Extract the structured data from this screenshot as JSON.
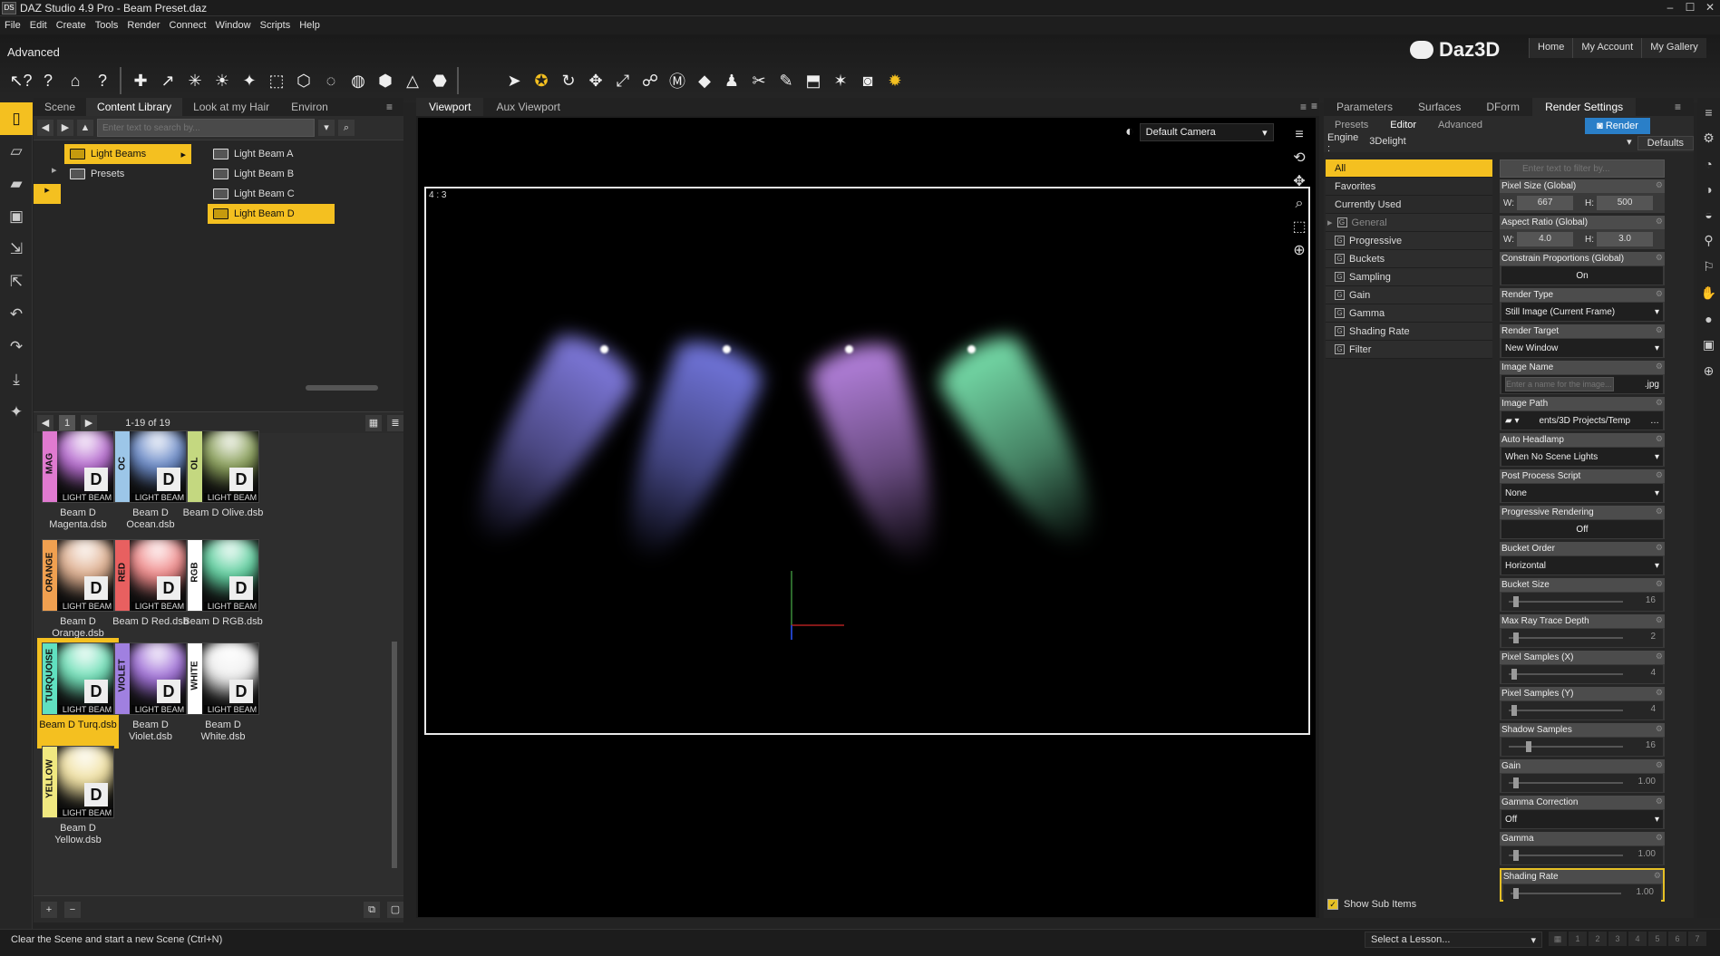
{
  "window": {
    "title": "DAZ Studio 4.9 Pro - Beam Preset.daz",
    "app_icon": "DS"
  },
  "menu": [
    "File",
    "Edit",
    "Create",
    "Tools",
    "Render",
    "Connect",
    "Window",
    "Scripts",
    "Help"
  ],
  "layout_label": "Advanced",
  "brand": {
    "name": "Daz3D"
  },
  "top_links": [
    "Home",
    "My Account",
    "My Gallery"
  ],
  "content_library": {
    "tabs": [
      "Scene",
      "Content Library",
      "Look at my Hair",
      "Environ"
    ],
    "active_tab": "Content Library",
    "search_placeholder": "Enter text to search by...",
    "folders_col1": [
      {
        "label": "Light Beams",
        "selected": true
      },
      {
        "label": "Presets",
        "selected": false
      }
    ],
    "folders_col2": [
      {
        "label": "Light Beam A"
      },
      {
        "label": "Light Beam B"
      },
      {
        "label": "Light Beam C"
      },
      {
        "label": "Light Beam D",
        "selected": true
      }
    ],
    "pager": "1-19 of 19",
    "page_num": "1",
    "items": [
      {
        "caption": "Beam D Magenta.dsb",
        "band": "MAG",
        "band_color": "#e07ad0",
        "glow": "#b76cd0"
      },
      {
        "caption": "Beam D Ocean.dsb",
        "band": "OC",
        "band_color": "#9cc6e8",
        "glow": "#6a8ac8"
      },
      {
        "caption": "Beam D Olive.dsb",
        "band": "OL",
        "band_color": "#c4d880",
        "glow": "#8aa05a"
      },
      {
        "caption": "Beam D Orange.dsb",
        "band": "ORANGE",
        "band_color": "#f0a050",
        "glow": "#e0b090"
      },
      {
        "caption": "Beam D Red.dsb",
        "band": "RED",
        "band_color": "#e86060",
        "glow": "#f08a8a"
      },
      {
        "caption": "Beam D RGB.dsb",
        "band": "RGB",
        "band_color": "#ffffff",
        "glow": "#60d0a0"
      },
      {
        "caption": "Beam D Turq.dsb",
        "band": "TURQUOISE",
        "band_color": "#60e0c0",
        "glow": "#70e0b8",
        "selected": true
      },
      {
        "caption": "Beam D Violet.dsb",
        "band": "VIOLET",
        "band_color": "#a080e0",
        "glow": "#a070d8"
      },
      {
        "caption": "Beam D White.dsb",
        "band": "WHITE",
        "band_color": "#ffffff",
        "glow": "#f0f0f0"
      },
      {
        "caption": "Beam D Yellow.dsb",
        "band": "YELLOW",
        "band_color": "#f0e880",
        "glow": "#f0e0a0"
      }
    ],
    "thumb_brand": "LIGHT BEAM",
    "thumb_letter": "D"
  },
  "viewport": {
    "tabs": [
      "Viewport",
      "Aux Viewport"
    ],
    "active_tab": "Viewport",
    "aspect": "4 : 3",
    "camera": "Default Camera",
    "beam_colors": [
      "#8a84f0",
      "#7c80f0",
      "#c48cf0",
      "#80f0b8"
    ]
  },
  "render_settings": {
    "tabs": [
      "Parameters",
      "Surfaces",
      "DForm",
      "Render Settings"
    ],
    "active_tab": "Render Settings",
    "sub_tabs": [
      "Presets",
      "Editor",
      "Advanced"
    ],
    "active_sub_tab": "Editor",
    "render_button": "Render",
    "engine_label": "Engine :",
    "engine_value": "3Delight",
    "defaults_button": "Defaults",
    "filter_placeholder": "Enter text to filter by...",
    "categories": [
      {
        "label": "All",
        "selected": true
      },
      {
        "label": "Favorites"
      },
      {
        "label": "Currently Used"
      },
      {
        "label": "General",
        "group": true,
        "expandable": true,
        "dim": true
      },
      {
        "label": "Progressive",
        "group": true
      },
      {
        "label": "Buckets",
        "group": true
      },
      {
        "label": "Sampling",
        "group": true
      },
      {
        "label": "Gain",
        "group": true
      },
      {
        "label": "Gamma",
        "group": true
      },
      {
        "label": "Shading Rate",
        "group": true
      },
      {
        "label": "Filter",
        "group": true
      }
    ],
    "show_sub_items": "Show Sub Items",
    "properties": [
      {
        "label": "Pixel Size (Global)",
        "kind": "wh",
        "w": "667",
        "h": "500"
      },
      {
        "label": "Aspect Ratio (Global)",
        "kind": "wh",
        "w": "4.0",
        "h": "3.0"
      },
      {
        "label": "Constrain Proportions (Global)",
        "kind": "toggle",
        "value": "On"
      },
      {
        "label": "Render Type",
        "kind": "drop",
        "value": "Still Image (Current Frame)"
      },
      {
        "label": "Render Target",
        "kind": "drop",
        "value": "New Window"
      },
      {
        "label": "Image Name",
        "kind": "name",
        "placeholder": "Enter a name for the image...",
        "ext": ".jpg"
      },
      {
        "label": "Image Path",
        "kind": "path",
        "value": "ents/3D Projects/Temp"
      },
      {
        "label": "Auto Headlamp",
        "kind": "drop",
        "value": "When No Scene Lights"
      },
      {
        "label": "Post Process Script",
        "kind": "drop",
        "value": "None"
      },
      {
        "label": "Progressive Rendering",
        "kind": "toggle",
        "value": "Off"
      },
      {
        "label": "Bucket Order",
        "kind": "drop",
        "value": "Horizontal"
      },
      {
        "label": "Bucket Size",
        "kind": "slider",
        "value": "16",
        "level": 0.05
      },
      {
        "label": "Max Ray Trace Depth",
        "kind": "slider",
        "value": "2",
        "level": 0.05
      },
      {
        "label": "Pixel Samples (X)",
        "kind": "slider",
        "value": "4",
        "level": 0.03
      },
      {
        "label": "Pixel Samples (Y)",
        "kind": "slider",
        "value": "4",
        "level": 0.03
      },
      {
        "label": "Shadow Samples",
        "kind": "slider",
        "value": "16",
        "level": 0.2
      },
      {
        "label": "Gain",
        "kind": "slider",
        "value": "1.00",
        "level": 0.05
      },
      {
        "label": "Gamma Correction",
        "kind": "drop",
        "value": "Off"
      },
      {
        "label": "Gamma",
        "kind": "slider",
        "value": "1.00",
        "level": 0.05
      },
      {
        "label": "Shading Rate",
        "kind": "slider",
        "value": "1.00",
        "level": 0.03,
        "highlight": true
      }
    ]
  },
  "status": {
    "text": "Clear the Scene and start a new Scene (Ctrl+N)",
    "lesson_placeholder": "Select a Lesson...",
    "lesson_steps": [
      "1",
      "2",
      "3",
      "4",
      "5",
      "6",
      "7"
    ]
  },
  "colors": {
    "accent": "#f4c020",
    "render_blue": "#2a7fc8"
  }
}
